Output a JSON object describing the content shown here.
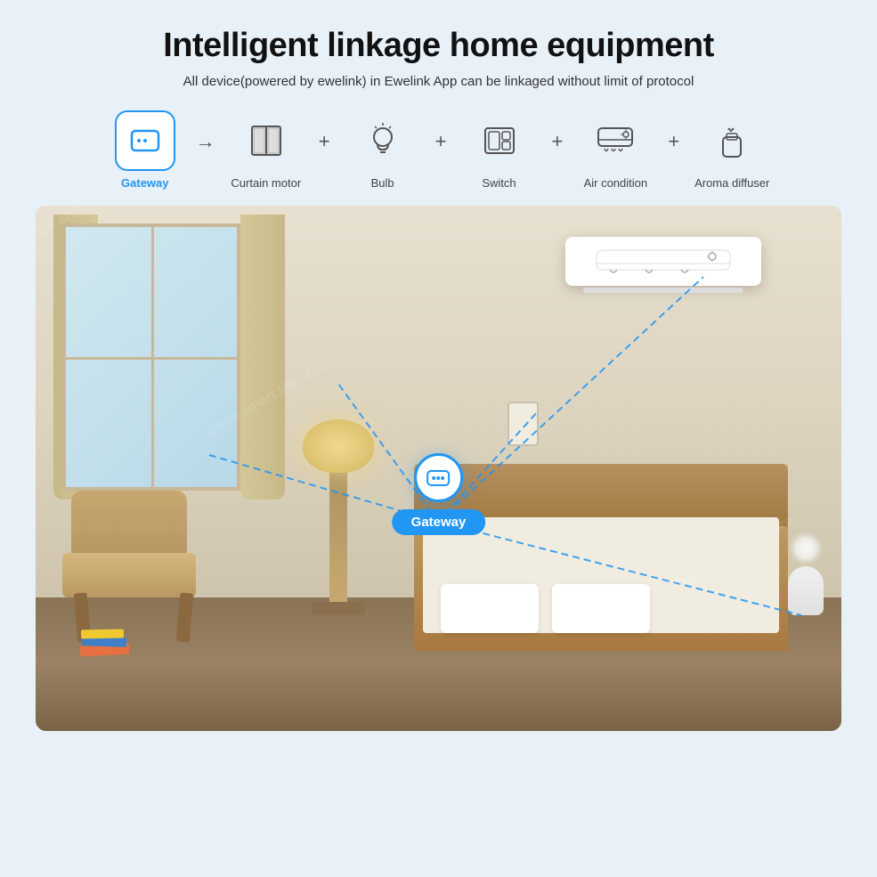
{
  "page": {
    "title": "Intelligent linkage home equipment",
    "subtitle": "All device(powered by ewelink) in Ewelink App can be linkaged without limit of protocol"
  },
  "devices": [
    {
      "id": "gateway",
      "label": "Gateway",
      "active": true
    },
    {
      "id": "curtain-motor",
      "label": "Curtain motor",
      "active": false
    },
    {
      "id": "bulb",
      "label": "Bulb",
      "active": false
    },
    {
      "id": "switch",
      "label": "Switch",
      "active": false
    },
    {
      "id": "air-condition",
      "label": "Air condition",
      "active": false
    },
    {
      "id": "aroma-diffuser",
      "label": "Aroma diffuser",
      "active": false
    }
  ],
  "room": {
    "gateway_label": "Gateway"
  },
  "watermark": "gleco smart life store"
}
